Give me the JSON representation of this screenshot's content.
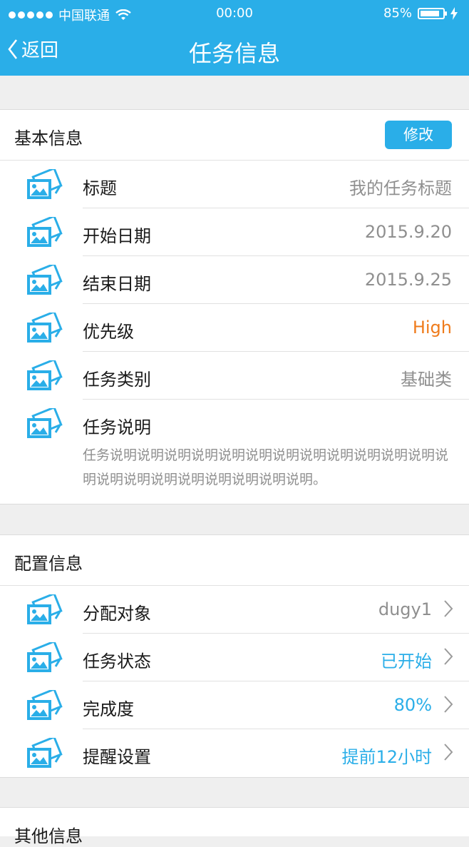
{
  "status_bar": {
    "carrier": "中国联通",
    "time": "00:00",
    "battery": "85%"
  },
  "nav": {
    "back_label": "返回",
    "title": "任务信息"
  },
  "basic": {
    "title": "基本信息",
    "edit_label": "修改",
    "rows": [
      {
        "label": "标题",
        "value": "我的任务标题"
      },
      {
        "label": "开始日期",
        "value": "2015.9.20"
      },
      {
        "label": "结束日期",
        "value": "2015.9.25"
      },
      {
        "label": "优先级",
        "value": "High"
      },
      {
        "label": "任务类别",
        "value": "基础类"
      }
    ],
    "description": {
      "label": "任务说明",
      "text": "任务说明说明说明说明说明说明说明说明说明说明说明说明说明说明说明说明说明说明说明说明说明。"
    }
  },
  "config": {
    "title": "配置信息",
    "rows": [
      {
        "label": "分配对象",
        "value": "dugy1"
      },
      {
        "label": "任务状态",
        "value": "已开始"
      },
      {
        "label": "完成度",
        "value": "80%"
      },
      {
        "label": "提醒设置",
        "value": "提前12小时"
      }
    ]
  },
  "other": {
    "title": "其他信息"
  },
  "colors": {
    "accent": "#2aaee8",
    "priority_high": "#ef7b1b",
    "muted": "#8f8f8f",
    "background": "#efefef"
  },
  "icons": {
    "row_icon": "image-icon",
    "chevron": "chevron-right-icon",
    "back": "chevron-left-icon",
    "wifi": "wifi-icon",
    "charging": "bolt-icon"
  },
  "battery_level": 0.85
}
